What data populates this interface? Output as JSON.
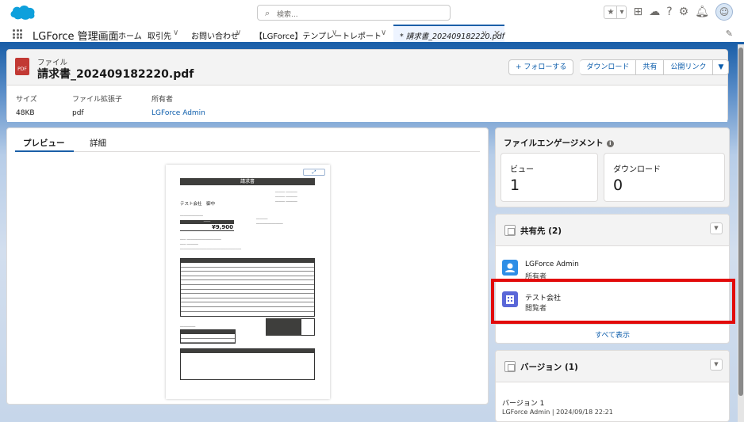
{
  "header": {
    "search_placeholder": "検索..."
  },
  "nav": {
    "app_name": "LGForce 管理画面",
    "items": [
      {
        "label": "ホーム"
      },
      {
        "label": "取引先"
      },
      {
        "label": "お問い合わせ"
      },
      {
        "label": "【LGForce】テンプレート"
      },
      {
        "label": "レポート"
      }
    ],
    "active_tab": "* 請求書_202409182220.pdf"
  },
  "record": {
    "object_label": "ファイル",
    "title": "請求書_202409182220.pdf",
    "buttons": {
      "follow": "+ フォローする",
      "download": "ダウンロード",
      "share": "共有",
      "public_link": "公開リンク"
    },
    "fields": [
      {
        "label": "サイズ",
        "value": "48KB"
      },
      {
        "label": "ファイル拡張子",
        "value": "pdf"
      },
      {
        "label": "所有者",
        "value": "LGForce Admin"
      }
    ]
  },
  "preview": {
    "tabs": [
      "プレビュー",
      "詳細"
    ],
    "doc": {
      "title": "請求書",
      "client": "テスト会社　御中",
      "amount": "¥9,900"
    }
  },
  "engagement": {
    "title": "ファイルエンゲージメント",
    "stats": [
      {
        "label": "ビュー",
        "value": "1"
      },
      {
        "label": "ダウンロード",
        "value": "0"
      }
    ]
  },
  "shared": {
    "title": "共有先 (2)",
    "people": [
      {
        "name": "LGForce Admin",
        "role": "所有者"
      },
      {
        "name": "テスト会社",
        "role": "閲覧者"
      }
    ],
    "show_all": "すべて表示"
  },
  "versions": {
    "title": "バージョン (1)",
    "label": "バージョン 1",
    "meta": "LGForce Admin | 2024/09/18 22:21"
  },
  "colors": {
    "brand": "#1b5fa8",
    "link": "#0b5cab",
    "highlight": "#e20a0a",
    "pdf": "#c23934"
  }
}
